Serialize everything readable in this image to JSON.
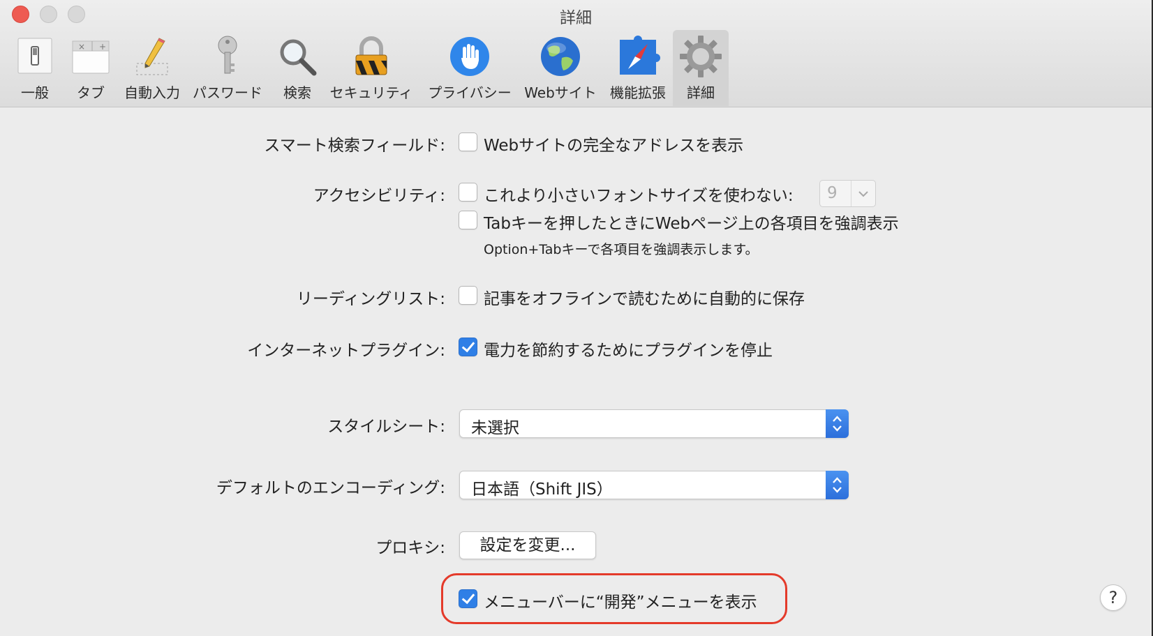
{
  "window": {
    "title": "詳細"
  },
  "toolbar": {
    "tabs": [
      {
        "id": "general",
        "label": "一般",
        "icon": "switch-icon"
      },
      {
        "id": "tabs",
        "label": "タブ",
        "icon": "tabs-icon"
      },
      {
        "id": "autofill",
        "label": "自動入力",
        "icon": "pencil-icon"
      },
      {
        "id": "passwords",
        "label": "パスワード",
        "icon": "key-icon"
      },
      {
        "id": "search",
        "label": "検索",
        "icon": "magnifier-icon"
      },
      {
        "id": "security",
        "label": "セキュリティ",
        "icon": "lock-icon"
      },
      {
        "id": "privacy",
        "label": "プライバシー",
        "icon": "hand-icon"
      },
      {
        "id": "websites",
        "label": "Webサイト",
        "icon": "globe-icon"
      },
      {
        "id": "extensions",
        "label": "機能拡張",
        "icon": "puzzle-compass-icon"
      },
      {
        "id": "advanced",
        "label": "詳細",
        "icon": "gear-icon",
        "selected": true
      }
    ]
  },
  "settings": {
    "smart_search": {
      "label": "スマート検索フィールド:",
      "option": "Webサイトの完全なアドレスを表示",
      "checked": false
    },
    "accessibility": {
      "label": "アクセシビリティ:",
      "min_font_option": "これより小さいフォントサイズを使わない:",
      "min_font_checked": false,
      "min_font_value": "9",
      "tab_option": "Tabキーを押したときにWebページ上の各項目を強調表示",
      "tab_checked": false,
      "tab_note": "Option+Tabキーで各項目を強調表示します。"
    },
    "reading_list": {
      "label": "リーディングリスト:",
      "option": "記事をオフラインで読むために自動的に保存",
      "checked": false
    },
    "plugins": {
      "label": "インターネットプラグイン:",
      "option": "電力を節約するためにプラグインを停止",
      "checked": true
    },
    "stylesheet": {
      "label": "スタイルシート:",
      "value": "未選択"
    },
    "encoding": {
      "label": "デフォルトのエンコーディング:",
      "value": "日本語（Shift JIS）"
    },
    "proxy": {
      "label": "プロキシ:",
      "button": "設定を変更..."
    },
    "develop_menu": {
      "option": "メニューバーに“開発”メニューを表示",
      "checked": true
    }
  },
  "help": {
    "label": "?"
  },
  "colors": {
    "accent": "#2f7fe6",
    "highlight": "#e43a2a",
    "close": "#ee5b52"
  }
}
